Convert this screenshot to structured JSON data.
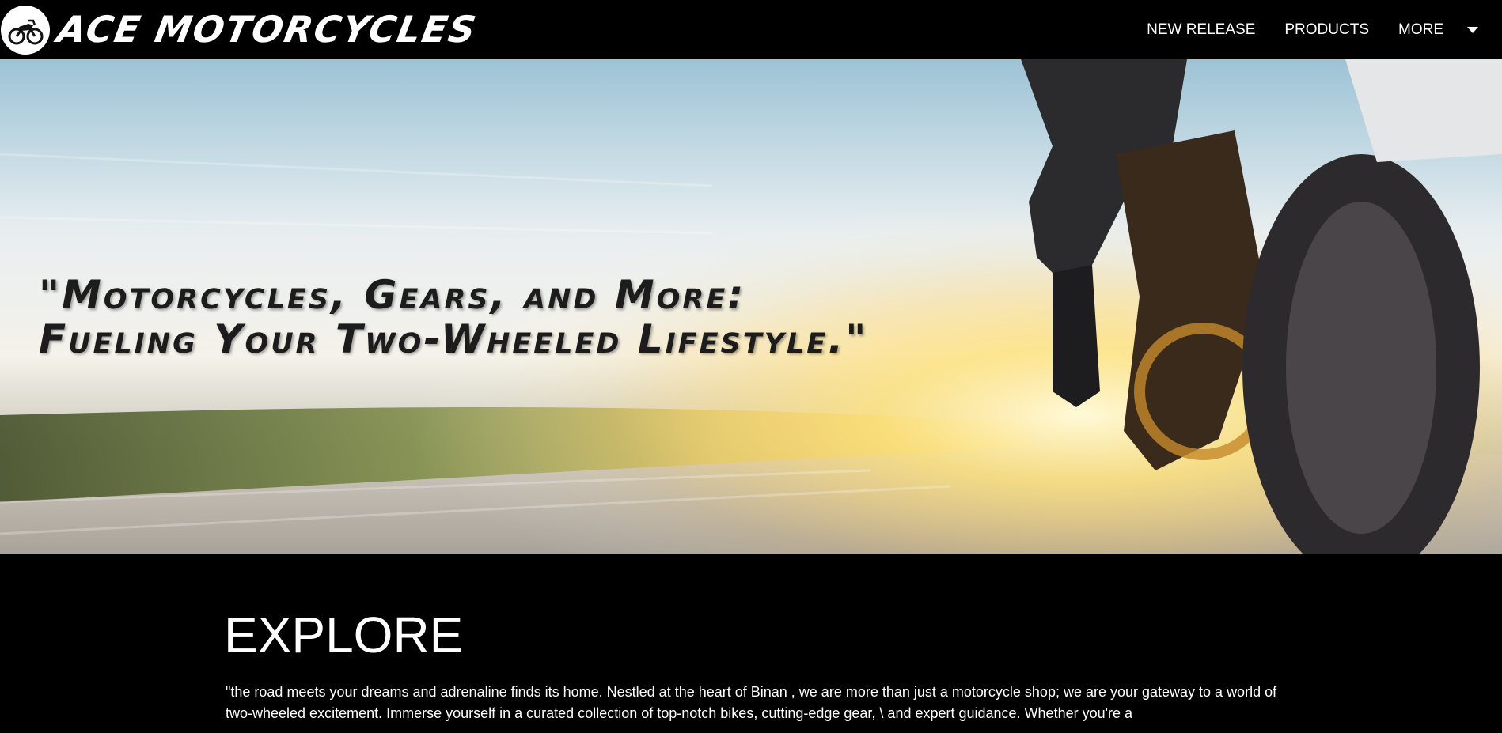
{
  "brand": {
    "name": "ACE MOTORCYCLES",
    "logo_icon": "motorcycle-icon"
  },
  "nav": {
    "items": [
      {
        "label": "NEW RELEASE"
      },
      {
        "label": "PRODUCTS"
      },
      {
        "label": "MORE"
      }
    ],
    "more_icon": "caret-down-icon"
  },
  "hero": {
    "line1": "\"Motorcycles, Gears, and More:",
    "line2": "Fueling Your Two-Wheeled Lifestyle.\""
  },
  "explore": {
    "title": "EXPLORE",
    "text": "\"the road meets your dreams and adrenaline finds its home. Nestled at the heart of Binan , we are more than just a motorcycle shop; we are your gateway to a world of two-wheeled excitement. Immerse yourself in a curated collection of top-notch bikes, cutting-edge gear, \\ and expert guidance. Whether you're a"
  },
  "colors": {
    "navbar_bg": "#000000",
    "text_light": "#ffffff",
    "tagline": "#1c1c1c"
  }
}
